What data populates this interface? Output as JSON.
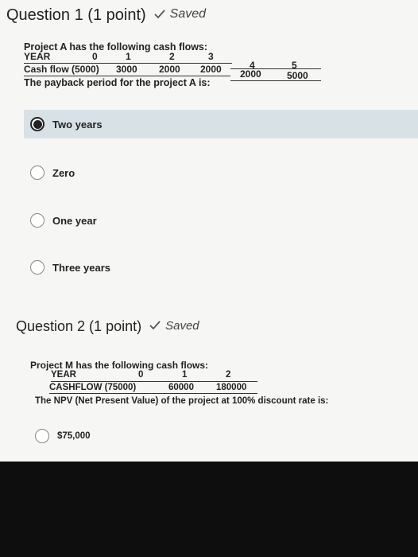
{
  "q1": {
    "title": "Question 1 (1 point)",
    "saved": "Saved",
    "intro": "Project A has the following cash flows:",
    "year_label": "YEAR",
    "years": [
      "0",
      "1",
      "2",
      "3",
      "4",
      "5"
    ],
    "cf_label": "Cash flow (5000)",
    "cf_values": [
      "3000",
      "2000",
      "2000",
      "2000",
      "5000"
    ],
    "question": "The payback period for the project A is:",
    "options": [
      "Two years",
      "Zero",
      "One year",
      "Three years"
    ],
    "selected_index": 0
  },
  "q2": {
    "title": "Question 2 (1 point)",
    "saved": "Saved",
    "intro": "Project M has the following cash flows:",
    "year_label": "YEAR",
    "years": [
      "0",
      "1",
      "2"
    ],
    "cf_label": "CASHFLOW (75000)",
    "cf_values": [
      "60000",
      "180000"
    ],
    "question": "The NPV (Net Present Value) of the project at 100% discount rate is:",
    "options": [
      "$75,000"
    ]
  }
}
